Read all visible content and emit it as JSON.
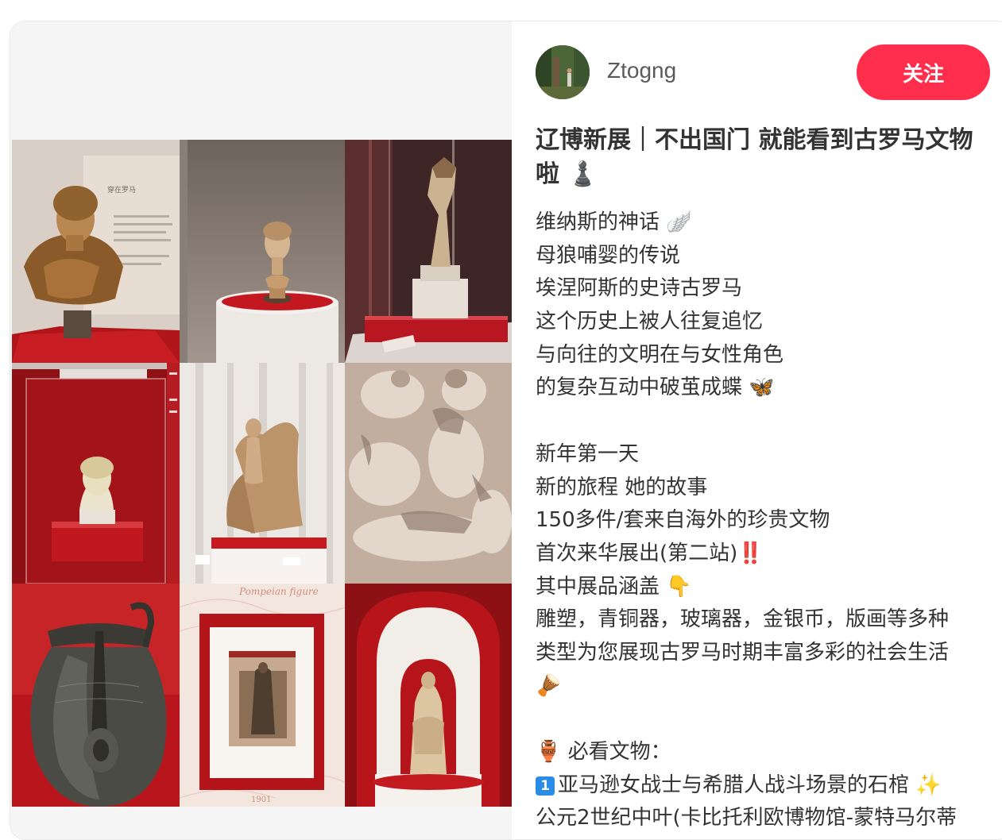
{
  "post": {
    "author": "Ztogng",
    "follow_label": "关注",
    "title": "辽博新展｜不出国门 就能看到古罗马文物啦 ♟️",
    "lines": [
      {
        "text": "维纳斯的神话 🪽"
      },
      {
        "text": "母狼哺婴的传说"
      },
      {
        "text": "埃涅阿斯的史诗古罗马"
      },
      {
        "text": "这个历史上被人往复追忆"
      },
      {
        "text": "与向往的文明在与女性角色"
      },
      {
        "text": "的复杂互动中破茧成蝶 🦋"
      },
      {
        "text": ""
      },
      {
        "text": "新年第一天"
      },
      {
        "text": "新的旅程 她的故事"
      },
      {
        "text": "150多件/套来自海外的珍贵文物"
      },
      {
        "text": "首次来华展出(第二站)‼️"
      },
      {
        "text": "其中展品涵盖 👇"
      },
      {
        "text": "雕塑，青铜器，玻璃器，金银币，版画等多种"
      },
      {
        "text": "类型为您展现古罗马时期丰富多彩的社会生活"
      },
      {
        "text": "🪘"
      },
      {
        "text": ""
      },
      {
        "text": "🏺 必看文物："
      },
      {
        "text": "亚马逊女战士与希腊人战斗场景的石棺 ✨",
        "keycap": "1"
      },
      {
        "text": "公元2世纪中叶(卡比托利欧博物馆-蒙特马尔蒂"
      }
    ]
  },
  "photos": [
    {
      "subject": "marble-bust-of-woman",
      "caption": "穿在罗马"
    },
    {
      "subject": "small-female-head-bust",
      "caption": ""
    },
    {
      "subject": "animal-topped-column-in-vitrine",
      "caption": ""
    },
    {
      "subject": "female-head-in-red-case",
      "caption": ""
    },
    {
      "subject": "aphrodite-statue-with-drape",
      "caption": ""
    },
    {
      "subject": "battle-relief-sarcophagus",
      "caption": ""
    },
    {
      "subject": "bronze-jug",
      "caption": ""
    },
    {
      "subject": "pompeian-figure-print",
      "caption": "Pompeian figure"
    },
    {
      "subject": "draped-woman-statue-in-niche",
      "caption": ""
    }
  ],
  "colors": {
    "accent": "#ff2e4d",
    "exhibit_red": "#b3141d",
    "text": "#333333",
    "author": "#5a5a5a"
  }
}
